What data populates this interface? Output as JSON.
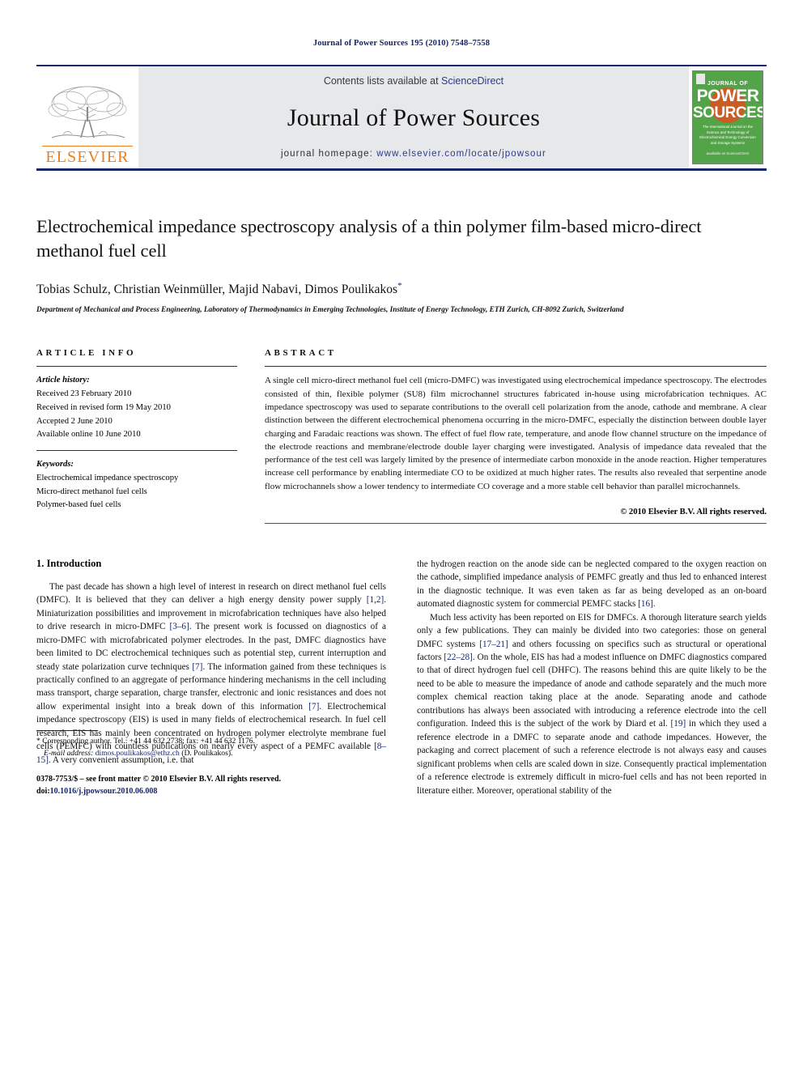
{
  "running_head": "Journal of Power Sources 195 (2010) 7548–7558",
  "masthead": {
    "publisher_name": "ELSEVIER",
    "contents_prefix": "Contents lists available at",
    "sciencedirect": "ScienceDirect",
    "journal_title": "Journal of Power Sources",
    "homepage_prefix": "journal homepage:",
    "homepage_url": "www.elsevier.com/locate/jpowsour",
    "cover": {
      "line1": "JOURNAL OF",
      "line2": "POWER",
      "line3": "SOURCES",
      "subtitle": "The International Journal on the Science and Technology of Electrochemical Energy Conversion and Storage Systems",
      "bottom": "available at\nScienceDirect"
    },
    "colors": {
      "rule": "#16266b",
      "band": "#e7e8ea",
      "elsevier_orange": "#ef7d1a",
      "cover_green": "#53a348",
      "link_blue": "#2b3a8f"
    }
  },
  "article": {
    "title": "Electrochemical impedance spectroscopy analysis of a thin polymer film-based micro-direct methanol fuel cell",
    "authors": "Tobias Schulz, Christian Weinmüller, Majid Nabavi, Dimos Poulikakos",
    "corresponding_marker": "*",
    "affiliation": "Department of Mechanical and Process Engineering, Laboratory of Thermodynamics in Emerging Technologies, Institute of Energy Technology, ETH Zurich, CH-8092 Zurich, Switzerland"
  },
  "article_info": {
    "heading": "ARTICLE INFO",
    "history_label": "Article history:",
    "history": [
      "Received 23 February 2010",
      "Received in revised form 19 May 2010",
      "Accepted 2 June 2010",
      "Available online 10 June 2010"
    ],
    "keywords_label": "Keywords:",
    "keywords": [
      "Electrochemical impedance spectroscopy",
      "Micro-direct methanol fuel cells",
      "Polymer-based fuel cells"
    ]
  },
  "abstract": {
    "heading": "ABSTRACT",
    "text": "A single cell micro-direct methanol fuel cell (micro-DMFC) was investigated using electrochemical impedance spectroscopy. The electrodes consisted of thin, flexible polymer (SU8) film microchannel structures fabricated in-house using microfabrication techniques. AC impedance spectroscopy was used to separate contributions to the overall cell polarization from the anode, cathode and membrane. A clear distinction between the different electrochemical phenomena occurring in the micro-DMFC, especially the distinction between double layer charging and Faradaic reactions was shown. The effect of fuel flow rate, temperature, and anode flow channel structure on the impedance of the electrode reactions and membrane/electrode double layer charging were investigated. Analysis of impedance data revealed that the performance of the test cell was largely limited by the presence of intermediate carbon monoxide in the anode reaction. Higher temperatures increase cell performance by enabling intermediate CO to be oxidized at much higher rates. The results also revealed that serpentine anode flow microchannels show a lower tendency to intermediate CO coverage and a more stable cell behavior than parallel microchannels.",
    "copyright": "© 2010 Elsevier B.V. All rights reserved."
  },
  "introduction": {
    "section_number_title": "1. Introduction",
    "left_paragraphs": [
      "The past decade has shown a high level of interest in research on direct methanol fuel cells (DMFC). It is believed that they can deliver a high energy density power supply [1,2]. Miniaturization possibilities and improvement in microfabrication techniques have also helped to drive research in micro-DMFC [3–6]. The present work is focussed on diagnostics of a micro-DMFC with microfabricated polymer electrodes. In the past, DMFC diagnostics have been limited to DC electrochemical techniques such as potential step, current interruption and steady state polarization curve techniques [7]. The information gained from these techniques is practically confined to an aggregate of performance hindering mechanisms in the cell including mass transport, charge separation, charge transfer, electronic and ionic resistances and does not allow experimental insight into a break down of this information [7]. Electrochemical impedance spectroscopy (EIS) is used in many fields of electrochemical research. In fuel cell research, EIS has mainly been concentrated on hydrogen polymer electrolyte membrane fuel cells (PEMFC) with countless publications on nearly every aspect of a PEMFC available [8–15]. A very convenient assumption, i.e. that"
    ],
    "right_paragraphs": [
      "the hydrogen reaction on the anode side can be neglected compared to the oxygen reaction on the cathode, simplified impedance analysis of PEMFC greatly and thus led to enhanced interest in the diagnostic technique. It was even taken as far as being developed as an on-board automated diagnostic system for commercial PEMFC stacks [16].",
      "Much less activity has been reported on EIS for DMFCs. A thorough literature search yields only a few publications. They can mainly be divided into two categories: those on general DMFC systems [17–21] and others focussing on specifics such as structural or operational factors [22–28]. On the whole, EIS has had a modest influence on DMFC diagnostics compared to that of direct hydrogen fuel cell (DHFC). The reasons behind this are quite likely to be the need to be able to measure the impedance of anode and cathode separately and the much more complex chemical reaction taking place at the anode. Separating anode and cathode contributions has always been associated with introducing a reference electrode into the cell configuration. Indeed this is the subject of the work by Diard et al. [19] in which they used a reference electrode in a DMFC to separate anode and cathode impedances. However, the packaging and correct placement of such a reference electrode is not always easy and causes significant problems when cells are scaled down in size. Consequently practical implementation of a reference electrode is extremely difficult in micro-fuel cells and has not been reported in literature either. Moreover, operational stability of the"
    ]
  },
  "footnote": {
    "corresponding": "* Corresponding author. Tel.: +41 44 632 2738; fax: +41 44 632 1176.",
    "email_label": "E-mail address:",
    "email": "dimos.poulikakos@ethz.ch",
    "email_suffix": "(D. Poulikakos).",
    "front_matter": "0378-7753/$ – see front matter © 2010 Elsevier B.V. All rights reserved.",
    "doi_label": "doi:",
    "doi": "10.1016/j.jpowsour.2010.06.008"
  }
}
